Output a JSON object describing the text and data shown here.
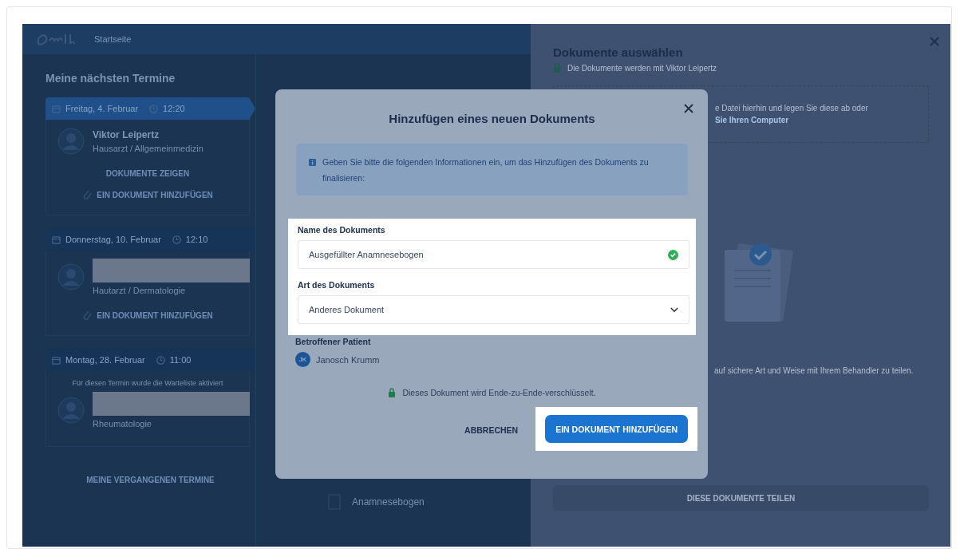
{
  "app": {
    "nav_label": "Startseite",
    "section_title": "Meine nächsten Termine",
    "appointments": [
      {
        "date": "Freitag, 4. Februar",
        "time": "12:20",
        "selected": true,
        "doctor": "Viktor Leipertz",
        "specialty": "Hausarzt / Allgemeinmedizin",
        "redacted": false,
        "actions": [
          "DOKUMENTE ZEIGEN",
          "EIN DOKUMENT HINZUFÜGEN"
        ]
      },
      {
        "date": "Donnerstag, 10. Februar",
        "time": "12:10",
        "selected": false,
        "specialty": "Hautarzt / Dermatologie",
        "redacted": true,
        "actions": [
          "EIN DOKUMENT HINZUFÜGEN"
        ]
      },
      {
        "date": "Montag, 28. Februar",
        "time": "11:00",
        "selected": false,
        "notice": "Für diesen Termin wurde die Warteliste aktiviert",
        "specialty": "Rheumatologie",
        "redacted": true
      }
    ],
    "past_link": "MEINE VERGANGENEN TERMINE",
    "document_item": {
      "title": "Anamnesebogen"
    }
  },
  "documents_panel": {
    "title": "Dokumente auswählen",
    "subtitle": "Die Dokumente werden mit Viktor Leipertz",
    "dropzone_text": "e Datei hierhin und legen Sie diese ab oder",
    "dropzone_link": "Sie Ihren Computer",
    "share_text": "auf sichere Art und Weise mit Ihrem Behandler zu teilen.",
    "share_button": "DIESE DOKUMENTE TEILEN"
  },
  "dialog": {
    "title": "Hinzufügen eines neuen Dokuments",
    "info": "Geben Sie bitte die folgenden Informationen ein, um das Hinzufügen des Dokuments zu finalisieren:",
    "fields_highlighted": true,
    "fields": [
      {
        "kind": "text",
        "label": "Name des Dokuments",
        "value": "Ausgefüllter Anamnesebogen",
        "valid": true
      },
      {
        "kind": "select",
        "label": "Art des Dokuments",
        "value": "Anderes Dokument"
      }
    ],
    "patient_label": "Betroffener Patient",
    "patient": {
      "initials": "JK",
      "name": "Janosch Krumm"
    },
    "encryption_note": "Dieses Dokument wird Ende-zu-Ende-verschlüsselt.",
    "buttons": [
      {
        "kind": "text",
        "label": "ABBRECHEN",
        "highlighted": false
      },
      {
        "kind": "primary",
        "label": "EIN DOKUMENT HINZUFÜGEN",
        "highlighted": true
      }
    ]
  }
}
